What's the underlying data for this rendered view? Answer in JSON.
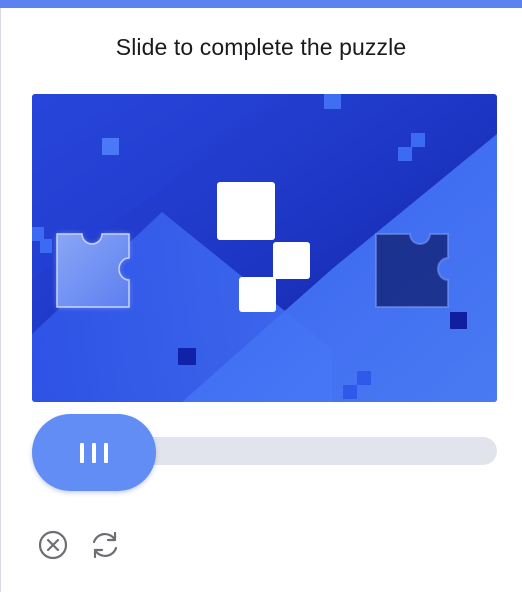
{
  "captcha": {
    "title": "Slide to complete the puzzle",
    "slider": {
      "position": 0,
      "handle_icon": "grip-lines-icon"
    },
    "actions": {
      "close_icon": "close-circle-icon",
      "refresh_icon": "refresh-icon"
    }
  },
  "colors": {
    "accent": "#628df5",
    "track": "#e1e4ec",
    "image_dark": "#1b2fb9",
    "image_light": "#3f6af1"
  }
}
